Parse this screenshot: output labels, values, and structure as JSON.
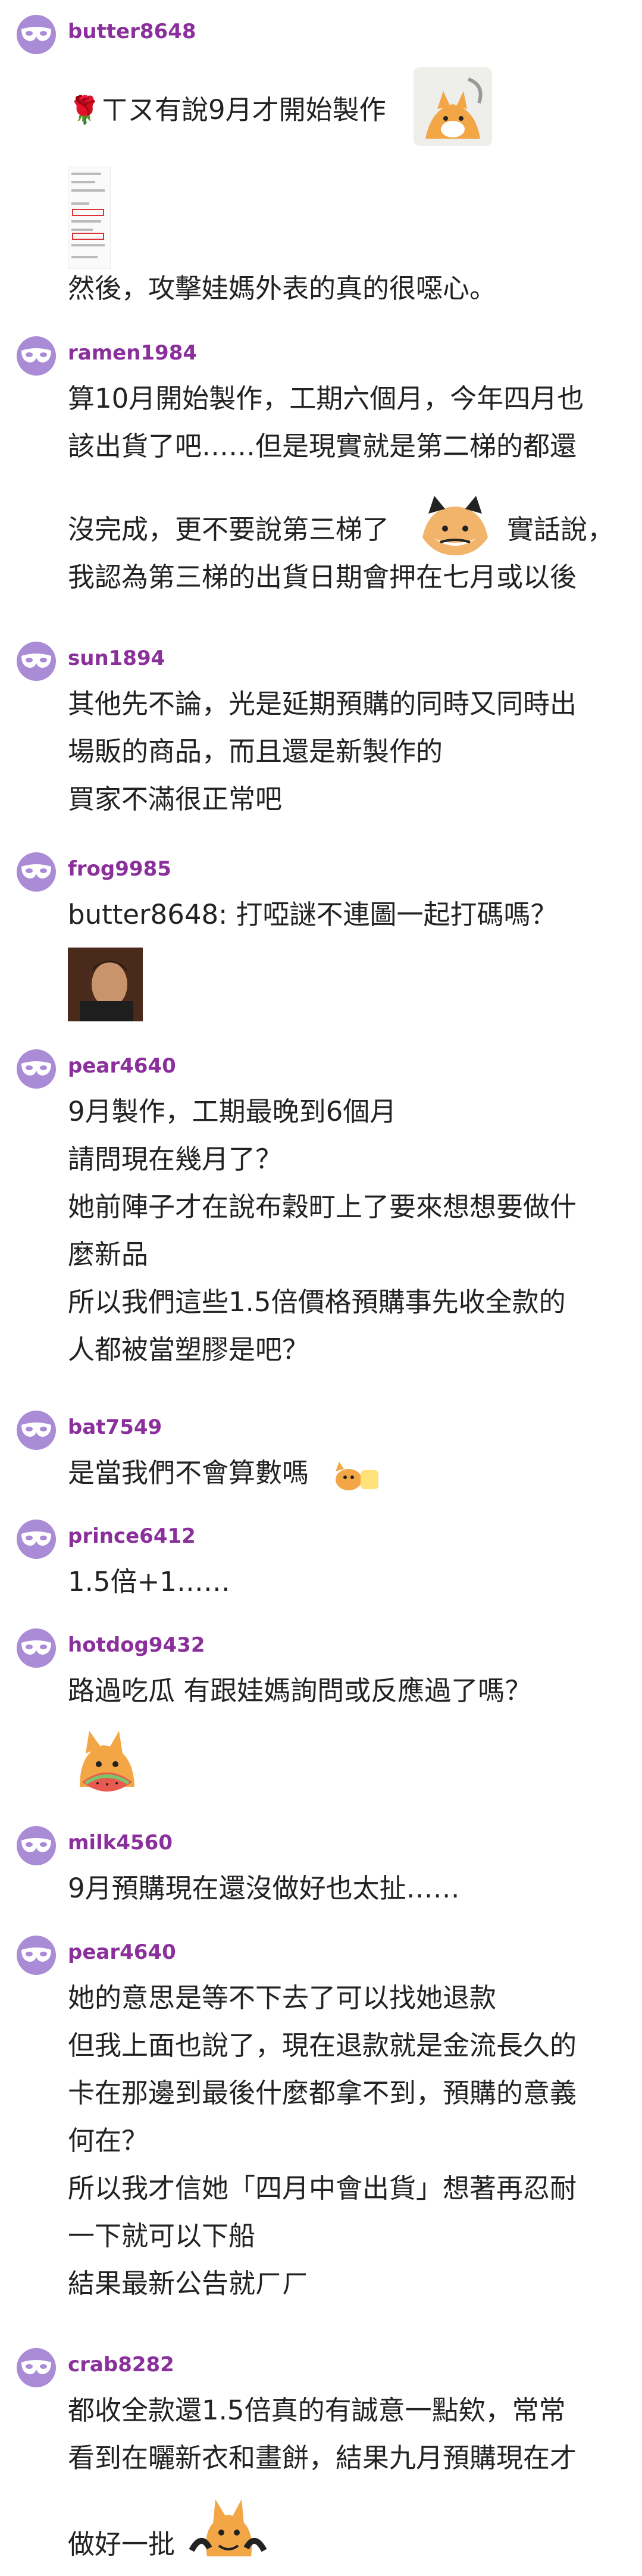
{
  "posts": [
    {
      "user": "butter8648",
      "lines": [
        "🌹ㄒㄡ有說9月才開始製作",
        "然後，攻擊娃媽外表的真的很噁心。"
      ]
    },
    {
      "user": "ramen1984",
      "lines": [
        "算10月開始製作，工期六個月，今年四月也",
        "該出貨了吧……但是現實就是第二梯的都還",
        "沒完成，更不要說第三梯了",
        "實話說，",
        "我認為第三梯的出貨日期會押在七月或以後"
      ]
    },
    {
      "user": "sun1894",
      "lines": [
        "其他先不論，光是延期預購的同時又同時出",
        "場販的商品，而且還是新製作的",
        "買家不滿很正常吧"
      ]
    },
    {
      "user": "frog9985",
      "lines": [
        "butter8648: 打啞謎不連圖一起打碼嗎？"
      ]
    },
    {
      "user": "pear4640",
      "lines": [
        "9月製作，工期最晚到6個月",
        "請問現在幾月了？",
        "她前陣子才在說布穀町上了要來想想要做什",
        "麼新品",
        "所以我們這些1.5倍價格預購事先收全款的",
        "人都被當塑膠是吧？"
      ]
    },
    {
      "user": "bat7549",
      "lines": [
        "是當我們不會算數嗎"
      ]
    },
    {
      "user": "prince6412",
      "lines": [
        "1.5倍+1……"
      ]
    },
    {
      "user": "hotdog9432",
      "lines": [
        "路過吃瓜 有跟娃媽詢問或反應過了嗎？"
      ]
    },
    {
      "user": "milk4560",
      "lines": [
        "9月預購現在還沒做好也太扯……"
      ]
    },
    {
      "user": "pear4640",
      "lines": [
        "她的意思是等不下去了可以找她退款",
        "但我上面也說了，現在退款就是金流長久的",
        "卡在那邊到最後什麼都拿不到，預購的意義",
        "何在？",
        "所以我才信她「四月中會出貨」想著再忍耐",
        "一下就可以下船",
        "結果最新公告就ㄏㄏ"
      ]
    },
    {
      "user": "crab8282",
      "lines": [
        "都收全款還1.5倍真的有誠意一點欸，常常",
        "看到在曬新衣和畫餅，結果九月預購現在才",
        "做好一批"
      ]
    }
  ],
  "colors": {
    "username": "#8a2f9c",
    "avatar": "#a98bd6",
    "text": "#222222"
  },
  "icons": {
    "avatar": "mask-icon"
  }
}
